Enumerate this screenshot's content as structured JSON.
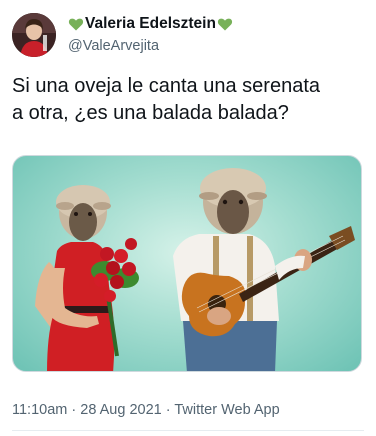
{
  "author": {
    "display_name": "Valeria Edelsztein",
    "handle": "@ValeArvejita",
    "name_decoration_icon": "green-heart-icon",
    "accent_color": "#78b159"
  },
  "tweet": {
    "text_line1": "Si una oveja le canta una serenata",
    "text_line2": "a otra, ¿es una balada balada?",
    "media_type": "image",
    "media_subjects": [
      "sheep-headed woman in red dress holding roses",
      "sheep-headed man playing guitar"
    ]
  },
  "meta": {
    "time": "11:10am",
    "separator": "·",
    "date": "28 Aug 2021",
    "source": "Twitter Web App"
  },
  "colors": {
    "text_primary": "#0f1419",
    "text_secondary": "#536471",
    "media_background": "#a4ddd0"
  }
}
